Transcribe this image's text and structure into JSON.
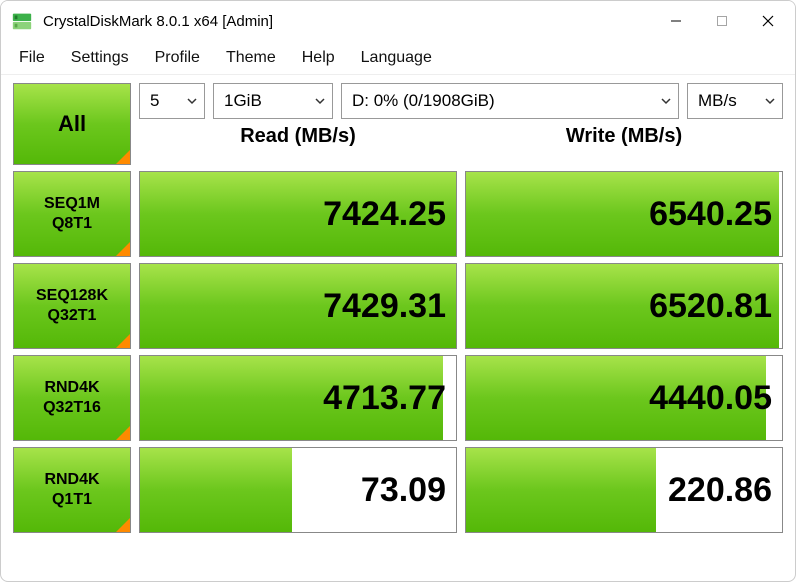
{
  "window": {
    "title": "CrystalDiskMark 8.0.1 x64 [Admin]"
  },
  "menu": {
    "file": "File",
    "settings": "Settings",
    "profile": "Profile",
    "theme": "Theme",
    "help": "Help",
    "language": "Language"
  },
  "controls": {
    "all": "All",
    "runs": "5",
    "size": "1GiB",
    "drive": "D: 0% (0/1908GiB)",
    "unit": "MB/s"
  },
  "headers": {
    "read": "Read (MB/s)",
    "write": "Write (MB/s)"
  },
  "rows": [
    {
      "label1": "SEQ1M",
      "label2": "Q8T1",
      "read": "7424.25",
      "write": "6540.25",
      "rbar": 100,
      "wbar": 99
    },
    {
      "label1": "SEQ128K",
      "label2": "Q32T1",
      "read": "7429.31",
      "write": "6520.81",
      "rbar": 100,
      "wbar": 99
    },
    {
      "label1": "RND4K",
      "label2": "Q32T16",
      "read": "4713.77",
      "write": "4440.05",
      "rbar": 96,
      "wbar": 95
    },
    {
      "label1": "RND4K",
      "label2": "Q1T1",
      "read": "73.09",
      "write": "220.86",
      "rbar": 48,
      "wbar": 60
    }
  ]
}
